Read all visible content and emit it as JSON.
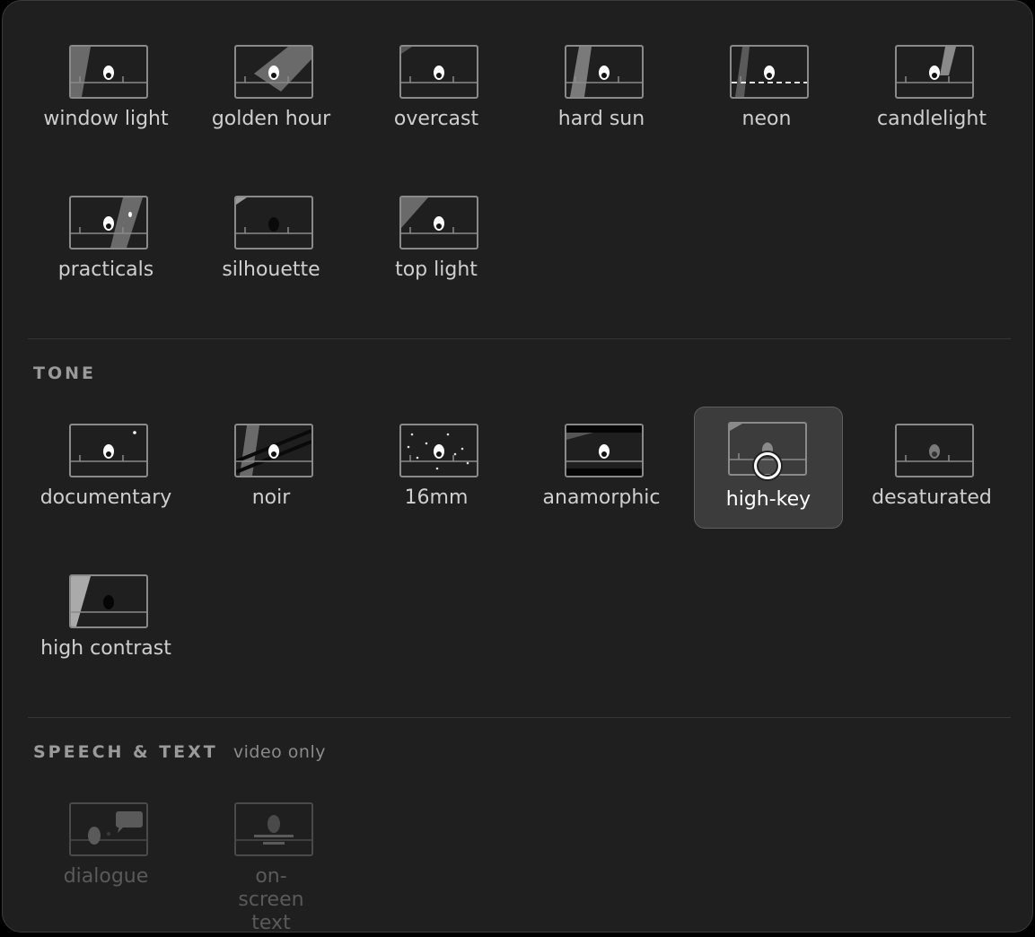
{
  "lighting": {
    "items": [
      {
        "label": "window light",
        "icon": "window-light-thumbnail"
      },
      {
        "label": "golden hour",
        "icon": "golden-hour-thumbnail"
      },
      {
        "label": "overcast",
        "icon": "overcast-thumbnail"
      },
      {
        "label": "hard sun",
        "icon": "hard-sun-thumbnail"
      },
      {
        "label": "neon",
        "icon": "neon-thumbnail"
      },
      {
        "label": "candlelight",
        "icon": "candlelight-thumbnail"
      },
      {
        "label": "practicals",
        "icon": "practicals-thumbnail"
      },
      {
        "label": "silhouette",
        "icon": "silhouette-thumbnail"
      },
      {
        "label": "top light",
        "icon": "top-light-thumbnail"
      }
    ]
  },
  "tone": {
    "title": "TONE",
    "selected": "high-key",
    "items": [
      {
        "label": "documentary",
        "icon": "documentary-thumbnail"
      },
      {
        "label": "noir",
        "icon": "noir-thumbnail"
      },
      {
        "label": "16mm",
        "icon": "16mm-thumbnail"
      },
      {
        "label": "anamorphic",
        "icon": "anamorphic-thumbnail"
      },
      {
        "label": "high-key",
        "icon": "high-key-thumbnail"
      },
      {
        "label": "desaturated",
        "icon": "desaturated-thumbnail"
      },
      {
        "label": "high contrast",
        "icon": "high-contrast-thumbnail"
      }
    ]
  },
  "speech": {
    "title": "SPEECH & TEXT",
    "subtitle": "video only",
    "items": [
      {
        "label": "dialogue",
        "icon": "dialogue-thumbnail",
        "enabled": false
      },
      {
        "label": "on-screen text",
        "icon": "on-screen-text-thumbnail",
        "enabled": false
      }
    ]
  },
  "colors": {
    "panel_bg": "#1f1f1f",
    "selected_bg": "#3c3c3c",
    "label": "#cfcfcf",
    "disabled_label": "#5a5a5a"
  }
}
